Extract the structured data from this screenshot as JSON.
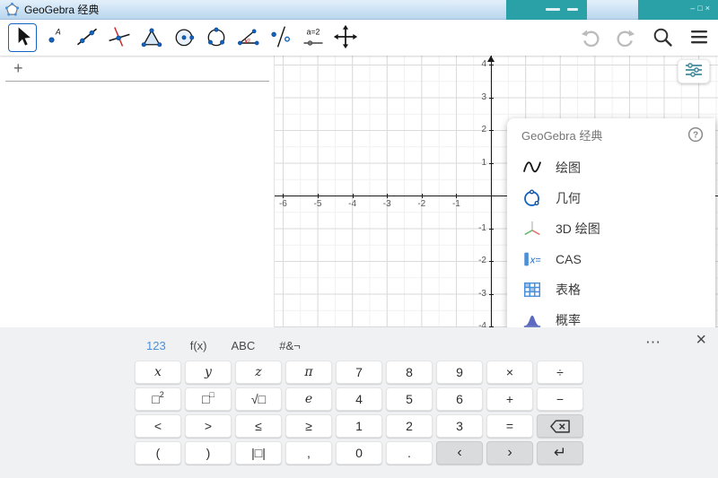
{
  "titlebar": {
    "title": "GeoGebra 经典"
  },
  "toolbar": {
    "tools": [
      {
        "name": "move",
        "selected": true
      },
      {
        "name": "point"
      },
      {
        "name": "line"
      },
      {
        "name": "special-line"
      },
      {
        "name": "polygon"
      },
      {
        "name": "circle"
      },
      {
        "name": "conic"
      },
      {
        "name": "angle"
      },
      {
        "name": "reflect"
      },
      {
        "name": "slider",
        "label": "a=2"
      },
      {
        "name": "move-view"
      }
    ],
    "right_icons": [
      "undo-icon",
      "redo-icon",
      "search-icon",
      "menu-icon"
    ]
  },
  "algebra": {
    "plus": "+"
  },
  "graphics": {
    "x_ticks": [
      -6,
      -5,
      -4,
      -3,
      -2,
      -1
    ],
    "y_ticks": [
      4,
      3,
      2,
      1,
      -1,
      -2,
      -3,
      -4
    ]
  },
  "app_menu": {
    "title": "GeoGebra 经典",
    "items": [
      {
        "label": "绘图",
        "icon": "graphing-icon"
      },
      {
        "label": "几何",
        "icon": "geometry-icon"
      },
      {
        "label": "3D 绘图",
        "icon": "graphing3d-icon"
      },
      {
        "label": "CAS",
        "icon": "cas-icon"
      },
      {
        "label": "表格",
        "icon": "spreadsheet-icon"
      },
      {
        "label": "概率",
        "icon": "probability-icon"
      }
    ]
  },
  "keyboard": {
    "tabs": [
      {
        "label": "123",
        "active": true
      },
      {
        "label": "f(x)"
      },
      {
        "label": "ABC"
      },
      {
        "label": "#&¬"
      }
    ],
    "more_label": "⋯",
    "close_label": "×",
    "rows": [
      [
        {
          "name": "x",
          "label": "x",
          "math": true
        },
        {
          "name": "y",
          "label": "y",
          "math": true
        },
        {
          "name": "z",
          "label": "z",
          "math": true
        },
        {
          "name": "pi",
          "label": "π",
          "math": true
        },
        {
          "name": "7",
          "label": "7"
        },
        {
          "name": "8",
          "label": "8"
        },
        {
          "name": "9",
          "label": "9"
        },
        {
          "name": "multiply",
          "label": "×"
        },
        {
          "name": "divide",
          "label": "÷"
        }
      ],
      [
        {
          "name": "square",
          "base": "□",
          "sup": "2"
        },
        {
          "name": "power",
          "base": "□",
          "sup": "□"
        },
        {
          "name": "sqrt",
          "label": "√□"
        },
        {
          "name": "e",
          "label": "e",
          "math": true
        },
        {
          "name": "4",
          "label": "4"
        },
        {
          "name": "5",
          "label": "5"
        },
        {
          "name": "6",
          "label": "6"
        },
        {
          "name": "plus",
          "label": "+"
        },
        {
          "name": "minus",
          "label": "−"
        }
      ],
      [
        {
          "name": "less-than",
          "label": "<"
        },
        {
          "name": "greater-than",
          "label": ">"
        },
        {
          "name": "less-equal",
          "label": "≤"
        },
        {
          "name": "greater-equal",
          "label": "≥"
        },
        {
          "name": "1",
          "label": "1"
        },
        {
          "name": "2",
          "label": "2"
        },
        {
          "name": "3",
          "label": "3"
        },
        {
          "name": "equals",
          "label": "="
        },
        {
          "name": "backspace",
          "icon": "backspace",
          "action": true
        }
      ],
      [
        {
          "name": "paren-left",
          "label": "("
        },
        {
          "name": "paren-right",
          "label": ")"
        },
        {
          "name": "abs",
          "label": "|□|"
        },
        {
          "name": "comma",
          "label": ","
        },
        {
          "name": "0",
          "label": "0"
        },
        {
          "name": "decimal",
          "label": "."
        },
        {
          "name": "left-arrow",
          "label": "‹",
          "action": true
        },
        {
          "name": "right-arrow",
          "label": "›",
          "action": true
        },
        {
          "name": "enter",
          "label": "↵",
          "action": true
        }
      ]
    ]
  },
  "colors": {
    "accent": "#1565c0",
    "tab_active": "#4a90d9",
    "background_window": "#2aa1a7"
  }
}
